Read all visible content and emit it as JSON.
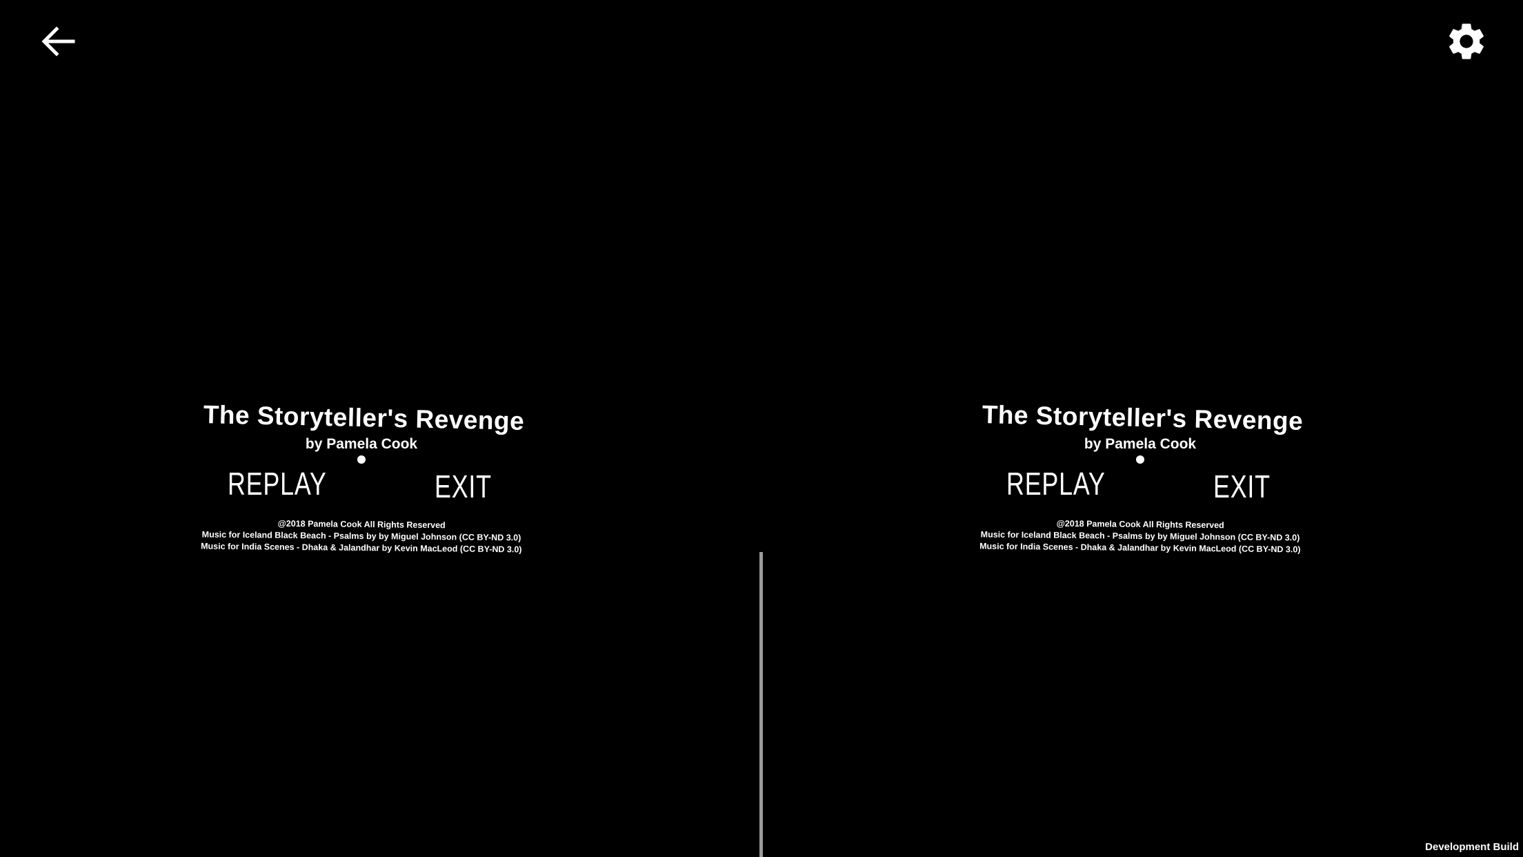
{
  "toolbar": {
    "back_icon": "arrow-left-icon",
    "settings_icon": "gear-icon"
  },
  "scene": {
    "title": "The Storyteller's Revenge",
    "author": "by Pamela Cook",
    "replay_label": "REPLAY",
    "exit_label": "EXIT",
    "credits": {
      "copyright": "@2018 Pamela Cook All Rights Reserved",
      "music_iceland": "Music for Iceland Black Beach - Psalms by  by Miguel Johnson (CC BY-ND 3.0)",
      "music_india": "Music for India Scenes - Dhaka & Jalandhar by Kevin MacLeod (CC BY-ND 3.0)"
    }
  },
  "footer": {
    "build_label": "Development Build"
  },
  "colors": {
    "background": "#000000",
    "text": "#ffffff",
    "divider": "#9a9a9a"
  }
}
